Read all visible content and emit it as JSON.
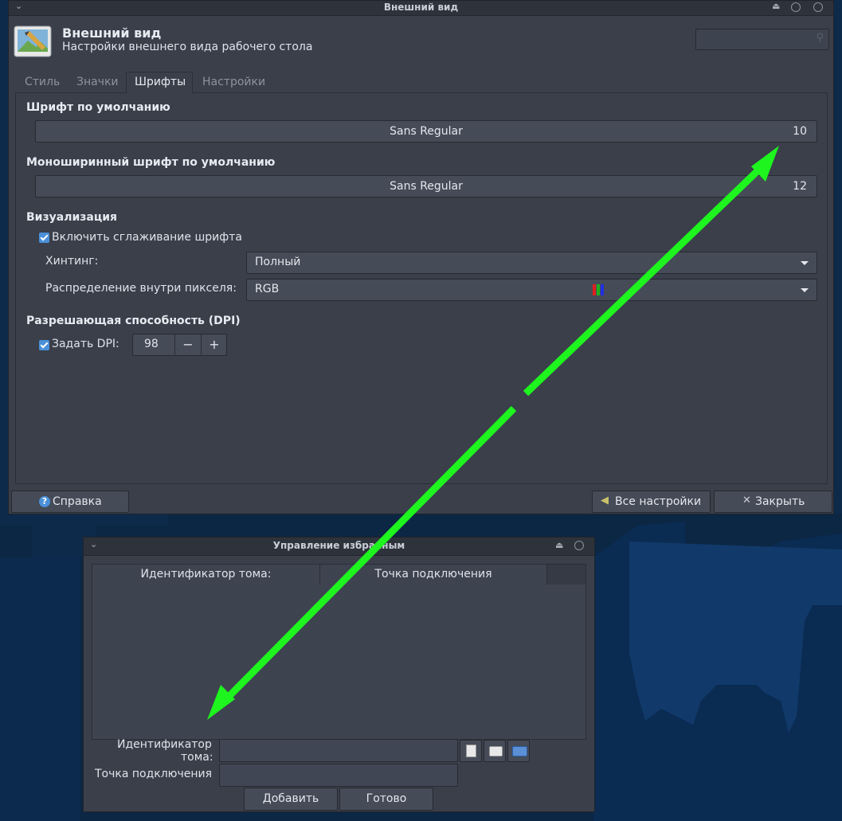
{
  "appearance_window": {
    "title": "Внешний вид",
    "header_title": "Внешний вид",
    "header_subtitle": "Настройки внешнего вида рабочего стола",
    "tabs": [
      {
        "label": "Стиль",
        "active": false
      },
      {
        "label": "Значки",
        "active": false
      },
      {
        "label": "Шрифты",
        "active": true
      },
      {
        "label": "Настройки",
        "active": false
      }
    ],
    "default_font": {
      "heading": "Шрифт по умолчанию",
      "name": "Sans Regular",
      "size": "10"
    },
    "mono_font": {
      "heading": "Моноширинный шрифт по умолчанию",
      "name": "Sans Regular",
      "size": "12"
    },
    "rendering": {
      "heading": "Визуализация",
      "antialias_label": "Включить сглаживание шрифта",
      "antialias_checked": true,
      "hinting_label": "Хинтинг:",
      "hinting_value": "Полный",
      "subpixel_label": "Распределение внутри пикселя:",
      "subpixel_value": "RGB"
    },
    "dpi": {
      "heading": "Разрешающая способность (DPI)",
      "label": "Задать DPI:",
      "checked": true,
      "value": "98",
      "minus": "−",
      "plus": "+"
    },
    "buttons": {
      "help": "Справка",
      "all_settings": "Все настройки",
      "close": "Закрыть"
    }
  },
  "favorites_window": {
    "title": "Управление избранным",
    "columns": [
      "Идентификатор тома:",
      "Точка подключения"
    ],
    "volume_label_line1": "Идентификатор",
    "volume_label_line2": "тома:",
    "mount_label": "Точка подключения",
    "add_button": "Добавить",
    "done_button": "Готово"
  },
  "colors": {
    "arrow": "#1ef41e",
    "accent": "#4a90d9"
  }
}
